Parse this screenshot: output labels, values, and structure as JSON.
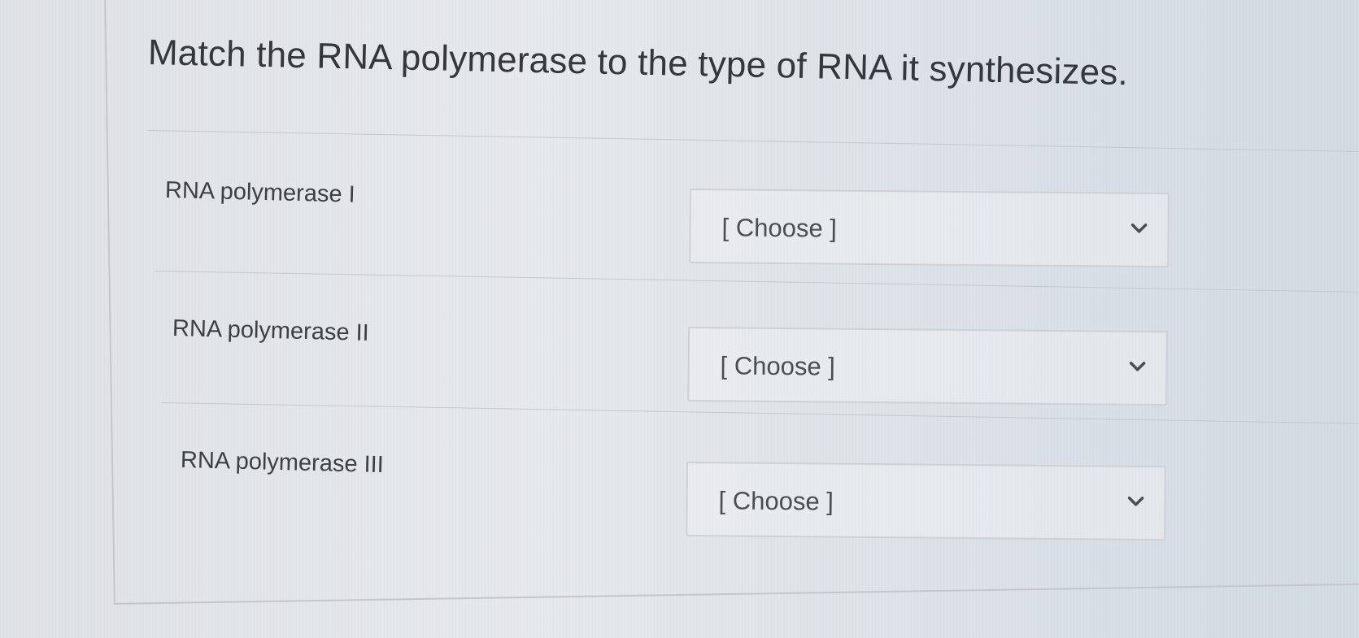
{
  "question": {
    "text": "Match the RNA polymerase to the type of RNA it synthesizes."
  },
  "rows": [
    {
      "label": "RNA polymerase I",
      "select_value": "[ Choose ]"
    },
    {
      "label": "RNA polymerase II",
      "select_value": "[ Choose ]"
    },
    {
      "label": "RNA polymerase III",
      "select_value": "[ Choose ]"
    }
  ],
  "icons": {
    "dropdown": "chevron-down-icon"
  }
}
